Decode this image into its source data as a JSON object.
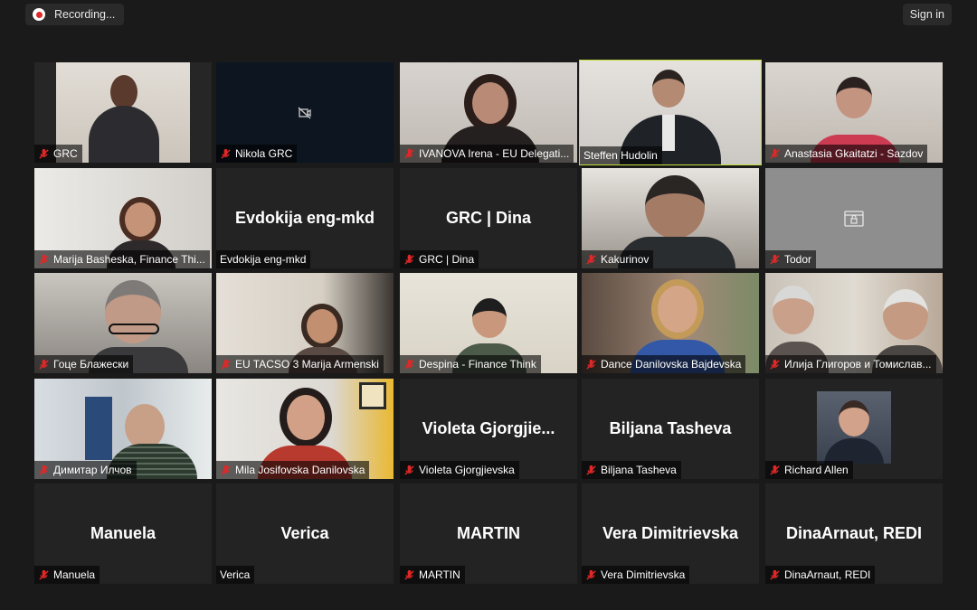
{
  "topbar": {
    "recording_label": "Recording...",
    "signin_label": "Sign in"
  },
  "participants": [
    {
      "name": "GRC",
      "muted": true
    },
    {
      "name": "Nikola GRC",
      "muted": true
    },
    {
      "name": "IVANOVA Irena - EU Delegati...",
      "muted": true
    },
    {
      "name": "Steffen Hudolin",
      "muted": false
    },
    {
      "name": "Anastasia Gkaitatzi - Sazdov",
      "muted": true
    },
    {
      "name": "Marija Basheska, Finance Thi...",
      "muted": true
    },
    {
      "name": "Evdokija eng-mkd",
      "muted": false,
      "display_name": "Evdokija eng-mkd"
    },
    {
      "name": "GRC | Dina",
      "muted": true,
      "display_name": "GRC | Dina"
    },
    {
      "name": "Kakurinov",
      "muted": true
    },
    {
      "name": "Todor",
      "muted": true
    },
    {
      "name": "Гоце Блажески",
      "muted": true
    },
    {
      "name": "EU TACSO 3 Marija Armenski",
      "muted": true
    },
    {
      "name": "Despina - Finance Think",
      "muted": true
    },
    {
      "name": "Dance Danilovska Bajdevska",
      "muted": true
    },
    {
      "name": "Илија Глигоров и Томислав...",
      "muted": true
    },
    {
      "name": "Димитар Илчов",
      "muted": true
    },
    {
      "name": "Mila Josifovska Danilovska",
      "muted": true
    },
    {
      "name": "Violeta Gjorgjievska",
      "muted": true,
      "display_name": "Violeta  Gjorgjie..."
    },
    {
      "name": "Biljana Tasheva",
      "muted": true,
      "display_name": "Biljana Tasheva"
    },
    {
      "name": "Richard Allen",
      "muted": true
    },
    {
      "name": "Manuela",
      "muted": true,
      "display_name": "Manuela"
    },
    {
      "name": "Verica",
      "muted": false,
      "display_name": "Verica"
    },
    {
      "name": "MARTIN",
      "muted": true,
      "display_name": "MARTIN"
    },
    {
      "name": "Vera Dimitrievska",
      "muted": true,
      "display_name": "Vera Dimitrievska"
    },
    {
      "name": "DinaArnaut, REDI",
      "muted": true,
      "display_name": "DinaArnaut, REDI"
    }
  ],
  "colors": {
    "active_speaker_border": "#c4de3b",
    "mute_icon": "#e02828",
    "tile_bg": "#232323"
  }
}
